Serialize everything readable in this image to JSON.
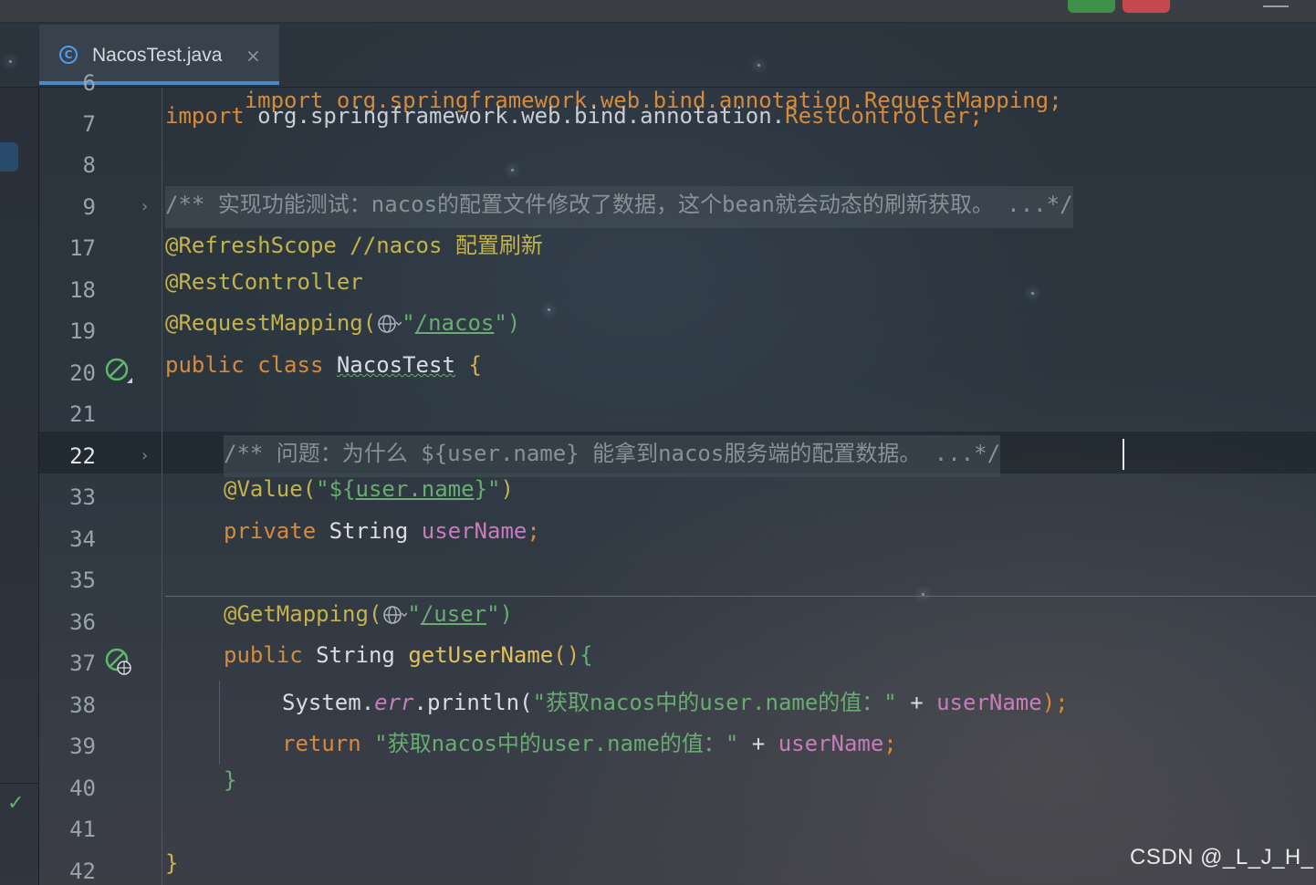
{
  "tab": {
    "filename": "NacosTest.java",
    "icon": "java-class-icon",
    "close": "×"
  },
  "gutter": {
    "line_numbers": [
      "6",
      "7",
      "8",
      "9",
      "17",
      "18",
      "19",
      "20",
      "21",
      "22",
      "33",
      "34",
      "35",
      "36",
      "37",
      "38",
      "39",
      "40",
      "41",
      "42"
    ]
  },
  "code": {
    "l6": "import org.springframework.web.bind.annotation.RequestMapping;",
    "l7_kw": "import ",
    "l7_pkg": "org.springframework.web.bind.annotation.",
    "l7_cls": "RestController",
    "l7_semi": ";",
    "l9_comment": "/** 实现功能测试：nacos的配置文件修改了数据，这个bean就会动态的刷新获取。 ...*/",
    "l17_ann": "@RefreshScope",
    "l17_cmt": " //nacos 配置刷新",
    "l18_ann": "@RestController",
    "l19_ann": "@RequestMapping(",
    "l19_q1": "\"",
    "l19_path": "/nacos",
    "l19_q2": "\")",
    "l20_kw": "public class ",
    "l20_name": "NacosTest",
    "l20_brace": " {",
    "l22_comment": "/** 问题：为什么 ${user.name} 能拿到nacos服务端的配置数据。 ...*/",
    "l33_ann": "@Value(",
    "l33_str_open": "\"${",
    "l33_key": "user.name",
    "l33_str_close": "}\"",
    "l33_paren": ")",
    "l34_kw": "private ",
    "l34_type": "String ",
    "l34_field": "userName",
    "l34_semi": ";",
    "l36_ann": "@GetMapping(",
    "l36_q1": "\"",
    "l36_path": "/user",
    "l36_q2": "\")",
    "l37_kw": "public ",
    "l37_type": "String ",
    "l37_fn": "getUserName",
    "l37_paren": "()",
    "l37_brace": "{",
    "l38_sys": "System.",
    "l38_err": "err",
    "l38_print": ".println(",
    "l38_str": "\"获取nacos中的user.name的值：\"",
    "l38_plus": " + ",
    "l38_field": "userName",
    "l38_end": ");",
    "l39_kw": "return ",
    "l39_str": "\"获取nacos中的user.name的值：\"",
    "l39_plus": " + ",
    "l39_field": "userName",
    "l39_semi": ";",
    "l40_brace": "}",
    "l42_brace": "}"
  },
  "status": {
    "check": "✓"
  },
  "watermark": "CSDN @_L_J_H_",
  "colors": {
    "keyword": "#d68a3c",
    "annotation": "#c4b34a",
    "string": "#6aab73",
    "comment": "#8b9097",
    "field": "#c77dbb",
    "method": "#e2c15a",
    "tab_underline": "#4a88c7"
  }
}
